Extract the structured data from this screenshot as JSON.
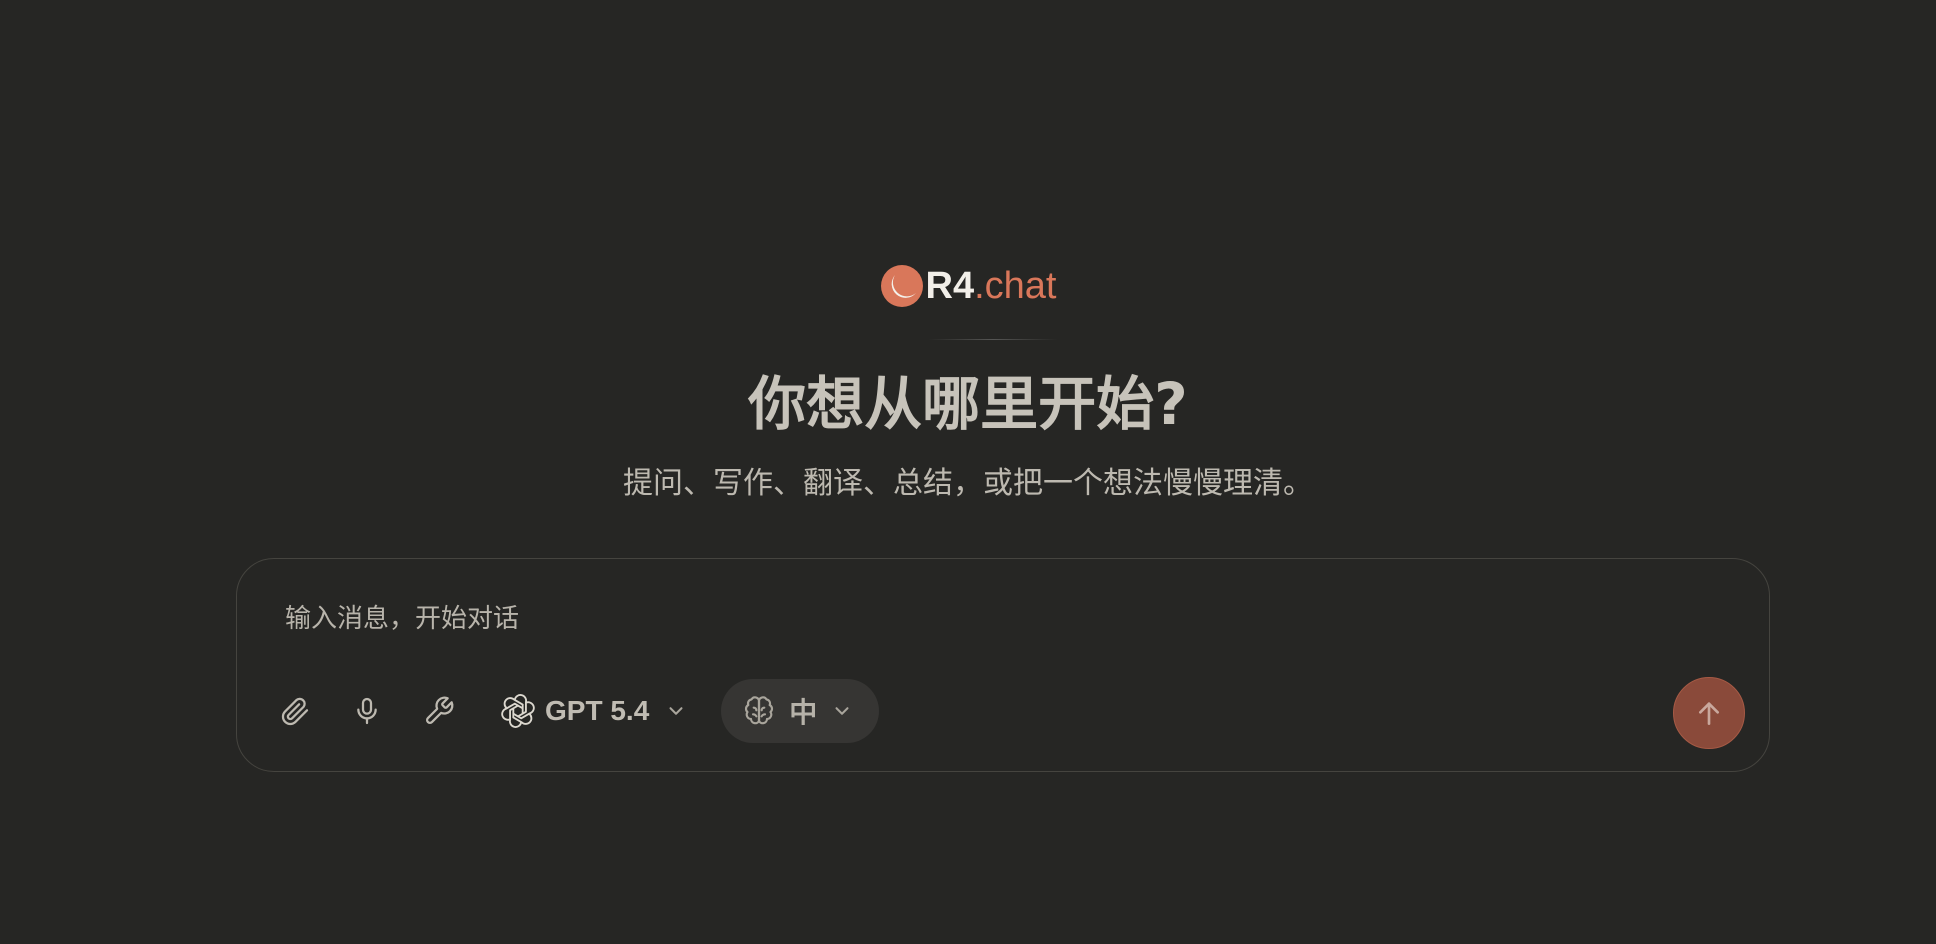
{
  "brand": {
    "name": "R4",
    "suffix": ".chat",
    "accent": "#d9775a",
    "logo_icon": "moon-logo-icon"
  },
  "hero": {
    "title": "你想从哪里开始?",
    "subtitle": "提问、写作、翻译、总结，或把一个想法慢慢理清。"
  },
  "composer": {
    "placeholder": "输入消息，开始对话",
    "value": "",
    "attach_icon": "paperclip-icon",
    "mic_icon": "microphone-icon",
    "tools_icon": "wrench-icon",
    "model": {
      "label": "GPT 5.4",
      "icon": "openai-icon",
      "chevron": "chevron-down-icon"
    },
    "reasoning": {
      "label": "中",
      "icon": "brain-icon",
      "chevron": "chevron-down-icon"
    },
    "send_icon": "arrow-up-icon",
    "send_color": "#8a4a3a"
  }
}
